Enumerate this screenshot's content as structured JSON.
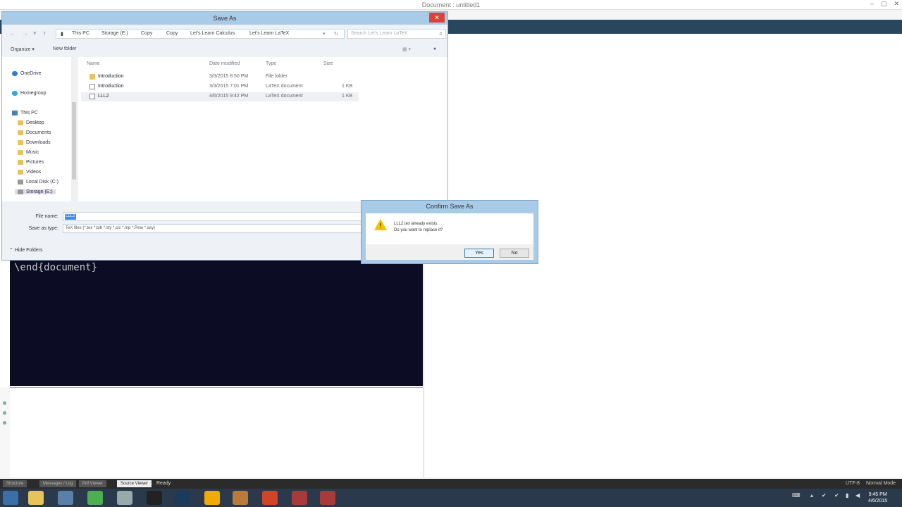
{
  "app": {
    "title": "Document : untitled1",
    "window_controls": [
      "–",
      "▢",
      "✕"
    ],
    "editor_line": "\\end{document}",
    "status_tabs": [
      "Structure",
      "Messages / Log",
      "Pdf Viewer",
      "Source Viewer"
    ],
    "status_text": "Ready",
    "encoding": "UTF-8",
    "mode": "Normal Mode"
  },
  "save_as": {
    "title": "Save As",
    "close_label": "✕",
    "breadcrumb": [
      "This PC",
      "Storage (E:)",
      "Copy",
      "Copy",
      "Let's Learn Calculus",
      "Let's Learn LaTeX"
    ],
    "search_placeholder": "Search Let's Learn LaTeX",
    "organize_label": "Organize ▾",
    "new_folder_label": "New folder",
    "nav": [
      {
        "label": "OneDrive",
        "icon": "cloud-icon"
      },
      {
        "label": "Homegroup",
        "icon": "homegroup-icon"
      },
      {
        "label": "This PC",
        "icon": "computer-icon"
      },
      {
        "label": "Desktop",
        "icon": "folder-icon"
      },
      {
        "label": "Documents",
        "icon": "folder-icon"
      },
      {
        "label": "Downloads",
        "icon": "folder-icon"
      },
      {
        "label": "Music",
        "icon": "folder-icon"
      },
      {
        "label": "Pictures",
        "icon": "folder-icon"
      },
      {
        "label": "Videos",
        "icon": "folder-icon"
      },
      {
        "label": "Local Disk (C:)",
        "icon": "drive-icon"
      },
      {
        "label": "Storage (E:)",
        "icon": "drive-icon"
      }
    ],
    "columns": [
      "Name",
      "Date modified",
      "Type",
      "Size"
    ],
    "files": [
      {
        "name": "Introduction",
        "date": "3/3/2015 8:50 PM",
        "type": "File folder",
        "size": ""
      },
      {
        "name": "Introduction",
        "date": "3/3/2015 7:01 PM",
        "type": "LaTeX document",
        "size": "1 KB"
      },
      {
        "name": "LLL2",
        "date": "4/6/2015 9:42 PM",
        "type": "LaTeX document",
        "size": "1 KB"
      }
    ],
    "file_name_label": "File name:",
    "file_name_value": "LLL2",
    "save_type_label": "Save as type:",
    "save_type_value": "TeX files (*.tex *.bib *.sty *.cls *.mp *.Rnw *.asy)",
    "hide_folders_label": "Hide Folders"
  },
  "confirm": {
    "title": "Confirm Save As",
    "line1": "LLL2.tex already exists.",
    "line2": "Do you want to replace it?",
    "yes_label": "Yes",
    "no_label": "No"
  },
  "taskbar": {
    "clock_time": "9:45 PM",
    "clock_date": "4/6/2015"
  },
  "colors": {
    "dialog_title": "#a8cbe8",
    "editor_bg": "#0c0c24",
    "toolbar_bg": "#28475f",
    "taskbar_bg": "#2a3a4c"
  }
}
